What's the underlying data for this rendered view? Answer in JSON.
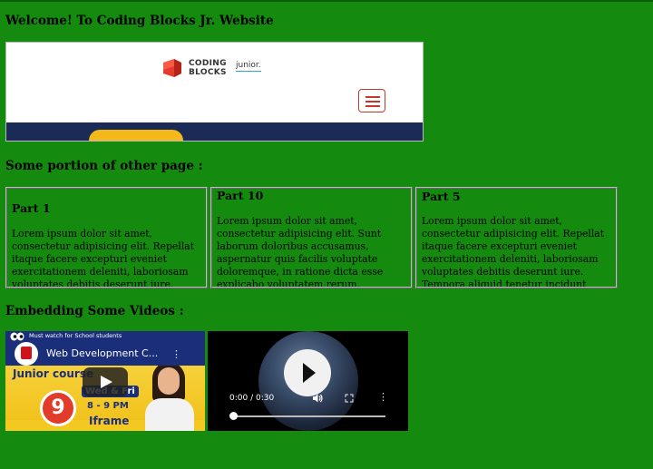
{
  "headings": {
    "welcome": "Welcome! To Coding Blocks Jr. Website",
    "other_page": "Some portion of other page :",
    "embedding": "Embedding Some Videos :"
  },
  "embedded_site": {
    "logo_line1": "CODING",
    "logo_line2": "BLOCKS",
    "logo_suffix": "junior.",
    "menu_icon": "hamburger-menu-icon"
  },
  "parts": [
    {
      "title": "Part 1",
      "text": "Lorem ipsum dolor sit amet, consectetur adipisicing elit. Repellat itaque facere excepturi eveniet exercitationem deleniti, laboriosam voluptates debitis deserunt iure."
    },
    {
      "title": "Part 10",
      "text": "Lorem ipsum dolor sit amet, consectetur adipisicing elit. Sunt laborum doloribus accusamus, aspernatur quis facilis voluptate doloremque, in ratione dicta esse explicabo voluptatem rerum."
    },
    {
      "title": "Part 5",
      "text": "Lorem ipsum dolor sit amet, consectetur adipisicing elit. Repellat itaque facere excepturi eveniet exercitationem deleniti, laboriosam voluptates debitis deserunt iure. Tempora aliquid tenetur incidunt"
    }
  ],
  "video1": {
    "title": "Web Development C...",
    "banner": "Must watch for School students",
    "thumb_heading": "Junior course",
    "episode": "9",
    "schedule": "Wed & Fri",
    "time": "8 - 9 PM",
    "topic": "Iframe"
  },
  "video2": {
    "time": "0:00 / 0:30"
  }
}
